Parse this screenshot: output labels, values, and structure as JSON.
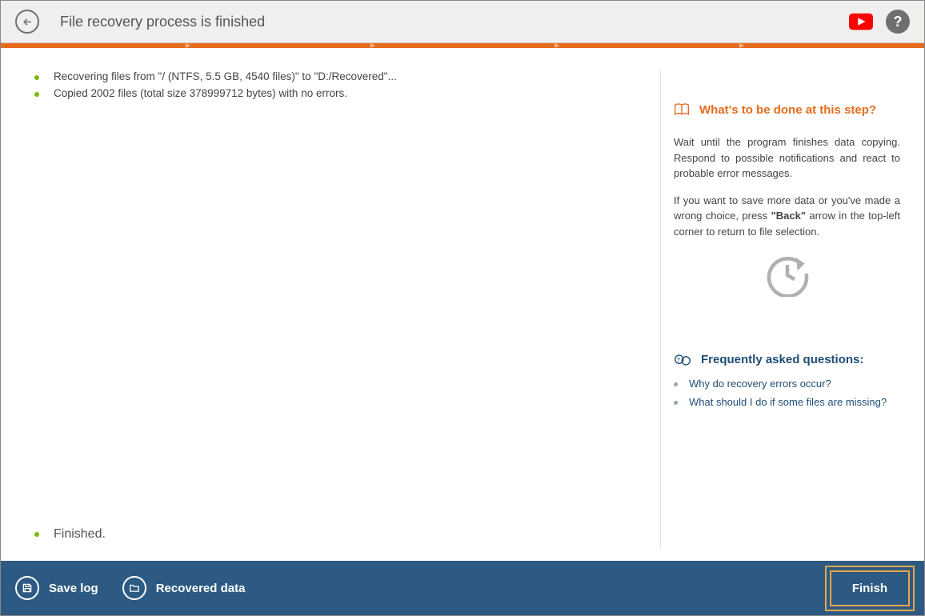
{
  "header": {
    "title": "File recovery process is finished"
  },
  "log": {
    "line1": "Recovering files from \"/ (NTFS, 5.5 GB, 4540 files)\" to \"D:/Recovered\"...",
    "line2": "Copied 2002 files (total size 378999712 bytes) with no errors."
  },
  "status": "Finished.",
  "sidebar": {
    "help_title": "What's to be done at this step?",
    "help_p1": "Wait until the program finishes data copying. Respond to possible notifications and react to probable error messages.",
    "help_p2_a": "If you want to save more data or you've made a wrong choice, press ",
    "help_p2_b": "\"Back\"",
    "help_p2_c": " arrow in the top-left corner to return to file selection.",
    "faq_title": "Frequently asked questions:",
    "faq1": "Why do recovery errors occur?",
    "faq2": "What should I do if some files are missing?"
  },
  "footer": {
    "save_log": "Save log",
    "recovered_data": "Recovered data",
    "finish": "Finish"
  }
}
